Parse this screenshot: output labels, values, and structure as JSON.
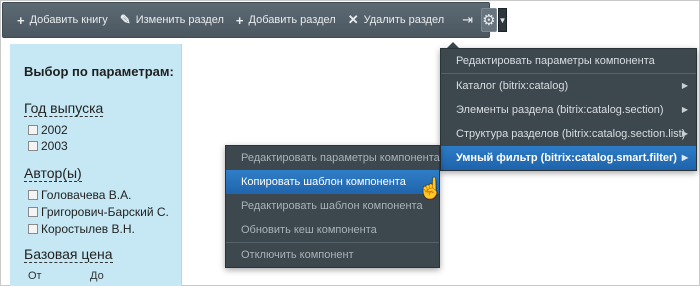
{
  "toolbar": {
    "add_book": "Добавить книгу",
    "edit_section": "Изменить раздел",
    "add_section": "Добавить раздел",
    "delete_section": "Удалить раздел",
    "icons": {
      "add": "plus-icon",
      "edit": "pencil-icon",
      "delete": "x-icon",
      "pin": "pin-icon",
      "settings": "gear-icon",
      "dropdown": "caret-down-icon"
    }
  },
  "filter": {
    "title": "Выбор по параметрам:",
    "year": {
      "label": "Год выпуска",
      "options": [
        "2002",
        "2003"
      ]
    },
    "author": {
      "label": "Автор(ы)",
      "options": [
        "Головачева В.А.",
        "Григорович-Барский С.",
        "Коростылев В.Н."
      ]
    },
    "price": {
      "label": "Базовая цена",
      "from": "От",
      "to": "До"
    }
  },
  "main_menu": {
    "items": [
      {
        "label": "Редактировать параметры компонента",
        "has_submenu": false
      },
      {
        "label": "Каталог (bitrix:catalog)",
        "has_submenu": true
      },
      {
        "label": "Элементы раздела (bitrix:catalog.section)",
        "has_submenu": true
      },
      {
        "label": "Структура разделов (bitrix:catalog.section.list)",
        "has_submenu": true
      },
      {
        "label": "Умный фильтр (bitrix:catalog.smart.filter)",
        "has_submenu": true,
        "active": true
      }
    ]
  },
  "context_menu": {
    "items": [
      {
        "label": "Редактировать параметры компонента"
      },
      {
        "label": "Копировать шаблон компонента",
        "active": true
      },
      {
        "label": "Редактировать шаблон компонента"
      },
      {
        "label": "Обновить кеш компонента"
      },
      {
        "label": "Отключить компонент"
      }
    ]
  },
  "colors": {
    "toolbar_bg": "#55626b",
    "menu_bg": "#3c474e",
    "highlight": "#2570bb",
    "filter_bg": "#c6e8f4"
  }
}
